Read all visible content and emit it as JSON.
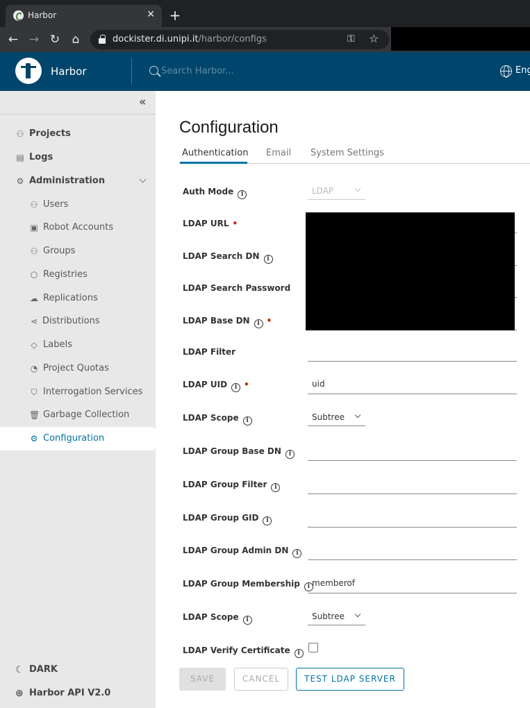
{
  "browser": {
    "tab_title": "Harbor",
    "url_host": "dockister.di.unipi.it",
    "url_path": "/harbor/configs"
  },
  "header": {
    "app_name": "Harbor",
    "search_placeholder": "Search Harbor...",
    "language": "Eng"
  },
  "sidebar": {
    "items": [
      {
        "label": "Projects",
        "icon": "projects-icon"
      },
      {
        "label": "Logs",
        "icon": "logs-icon"
      },
      {
        "label": "Administration",
        "icon": "administration-icon"
      }
    ],
    "admin_items": [
      {
        "label": "Users",
        "icon": "users-icon"
      },
      {
        "label": "Robot Accounts",
        "icon": "robot-icon"
      },
      {
        "label": "Groups",
        "icon": "groups-icon"
      },
      {
        "label": "Registries",
        "icon": "registries-icon"
      },
      {
        "label": "Replications",
        "icon": "replications-icon"
      },
      {
        "label": "Distributions",
        "icon": "distributions-icon"
      },
      {
        "label": "Labels",
        "icon": "labels-icon"
      },
      {
        "label": "Project Quotas",
        "icon": "quotas-icon"
      },
      {
        "label": "Interrogation Services",
        "icon": "shield-icon"
      },
      {
        "label": "Garbage Collection",
        "icon": "trash-icon"
      },
      {
        "label": "Configuration",
        "icon": "gear-icon"
      }
    ],
    "active": "Configuration",
    "footer": {
      "theme": "DARK",
      "api": "Harbor API V2.0"
    }
  },
  "main": {
    "title": "Configuration",
    "tabs": [
      {
        "label": "Authentication"
      },
      {
        "label": "Email"
      },
      {
        "label": "System Settings"
      }
    ],
    "active_tab": "Authentication",
    "fields": {
      "auth_mode": {
        "label": "Auth Mode",
        "value": "LDAP"
      },
      "ldap_url": {
        "label": "LDAP URL"
      },
      "ldap_search_dn": {
        "label": "LDAP Search DN"
      },
      "ldap_search_password": {
        "label": "LDAP Search Password"
      },
      "ldap_base_dn": {
        "label": "LDAP Base DN"
      },
      "ldap_filter": {
        "label": "LDAP Filter",
        "value": ""
      },
      "ldap_uid": {
        "label": "LDAP UID",
        "value": "uid"
      },
      "ldap_scope": {
        "label": "LDAP Scope",
        "value": "Subtree"
      },
      "ldap_group_base_dn": {
        "label": "LDAP Group Base DN",
        "value": ""
      },
      "ldap_group_filter": {
        "label": "LDAP Group Filter",
        "value": ""
      },
      "ldap_group_gid": {
        "label": "LDAP Group GID",
        "value": ""
      },
      "ldap_group_admin_dn": {
        "label": "LDAP Group Admin DN",
        "value": ""
      },
      "ldap_group_membership": {
        "label": "LDAP Group Membership",
        "value": "memberof"
      },
      "ldap_group_scope": {
        "label": "LDAP Scope",
        "value": "Subtree"
      },
      "ldap_verify_cert": {
        "label": "LDAP Verify Certificate",
        "checked": false
      }
    },
    "buttons": {
      "save": "SAVE",
      "cancel": "CANCEL",
      "test": "TEST LDAP SERVER"
    }
  },
  "colors": {
    "header_bg": "#00456b",
    "accent": "#0072a3",
    "required": "#c92100"
  }
}
